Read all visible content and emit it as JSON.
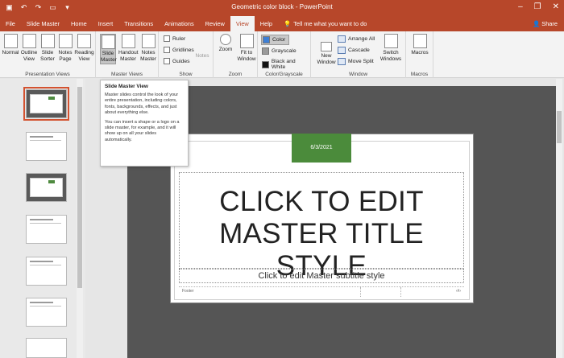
{
  "titlebar": {
    "title": "Geometric color block  -  PowerPoint",
    "qat": [
      "save-icon",
      "undo-icon",
      "redo-icon",
      "start-from-beginning-icon",
      "customize-icon"
    ],
    "win": [
      "–",
      "❐",
      "✕"
    ]
  },
  "tabs": [
    {
      "label": "File"
    },
    {
      "label": "Slide Master"
    },
    {
      "label": "Home"
    },
    {
      "label": "Insert"
    },
    {
      "label": "Transitions"
    },
    {
      "label": "Animations"
    },
    {
      "label": "Review"
    },
    {
      "label": "View",
      "active": true
    },
    {
      "label": "Help"
    }
  ],
  "tell": "Tell me what you want to do",
  "share": "Share",
  "ribbon": {
    "presentation_views": {
      "label": "Presentation Views",
      "buttons": [
        "Normal",
        "Outline View",
        "Slide Sorter",
        "Notes Page",
        "Reading View"
      ]
    },
    "master_views": {
      "label": "Master Views",
      "buttons": [
        "Slide Master",
        "Handout Master",
        "Notes Master"
      ]
    },
    "show": {
      "label": "Show",
      "items": [
        "Ruler",
        "Gridlines",
        "Guides"
      ],
      "notes": "Notes"
    },
    "zoom": {
      "label": "Zoom",
      "buttons": [
        "Zoom",
        "Fit to Window"
      ]
    },
    "color": {
      "label": "Color/Grayscale",
      "items": [
        "Color",
        "Grayscale",
        "Black and White"
      ]
    },
    "window": {
      "label": "Window",
      "new_window": "New Window",
      "items": [
        "Arrange All",
        "Cascade",
        "Move Split"
      ],
      "switch": "Switch Windows"
    },
    "macros": {
      "label": "Macros",
      "button": "Macros"
    }
  },
  "tooltip": {
    "title": "Slide Master View",
    "p1": "Master slides control the look of your entire presentation, including colors, fonts, backgrounds, effects, and just about everything else.",
    "p2": "You can insert a shape or a logo on a slide master, for example, and it will show up on all your slides automatically."
  },
  "thumb_titles": [
    "CLICK TO EDIT MASTER TITLE STYLE",
    "Click to edit Master title style",
    "CLICK TO EDIT MASTER TITLE STYLE",
    "Click to edit Master title style",
    "Click to edit Master title style",
    "Click to edit Master title style"
  ],
  "slide": {
    "date": "6/3/2021",
    "title": "CLICK TO EDIT MASTER TITLE STYLE",
    "subtitle": "Click to edit Master subtitle style",
    "footer": "Footer"
  },
  "colors": {
    "accent": "#b7472a",
    "green": "#4b8b3b",
    "canvas": "#555555"
  }
}
